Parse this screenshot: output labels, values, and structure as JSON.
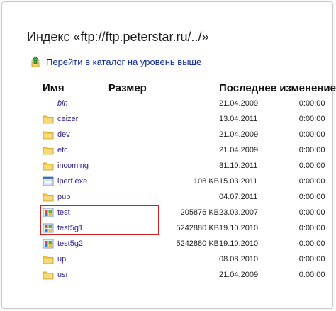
{
  "page": {
    "title": "Индекс «ftp://ftp.peterstar.ru/../»",
    "up_link": "Перейти в каталог на уровень выше"
  },
  "columns": {
    "name": "Имя",
    "size": "Размер",
    "modified": "Последнее изменение"
  },
  "rows": [
    {
      "name": "bin",
      "icon": "none",
      "size": "",
      "date": "21.04.2009",
      "time": "0:00:00",
      "style": "italic"
    },
    {
      "name": "ceizer",
      "icon": "folder-icon",
      "size": "",
      "date": "13.04.2011",
      "time": "0:00:00",
      "style": "normal"
    },
    {
      "name": "dev",
      "icon": "folder-icon",
      "size": "",
      "date": "21.04.2009",
      "time": "0:00:00",
      "style": "normal"
    },
    {
      "name": "etc",
      "icon": "folder-icon",
      "size": "",
      "date": "21.04.2009",
      "time": "0:00:00",
      "style": "normal"
    },
    {
      "name": "incoming",
      "icon": "folder-icon",
      "size": "",
      "date": "31.10.2011",
      "time": "0:00:00",
      "style": "normal"
    },
    {
      "name": "iperf.exe",
      "icon": "exe-file-icon",
      "size": "108 KB",
      "date": "15.03.2011",
      "time": "0:00:00",
      "style": "normal"
    },
    {
      "name": "pub",
      "icon": "folder-icon",
      "size": "",
      "date": "04.07.2011",
      "time": "0:00:00",
      "style": "normal"
    },
    {
      "name": "test",
      "icon": "windows-file-icon",
      "size": "205876 KB",
      "date": "23.03.2007",
      "time": "0:00:00",
      "style": "normal"
    },
    {
      "name": "test5g1",
      "icon": "windows-file-icon",
      "size": "5242880 KB",
      "date": "19.10.2010",
      "time": "0:00:00",
      "style": "normal"
    },
    {
      "name": "test5g2",
      "icon": "windows-file-icon",
      "size": "5242880 KB",
      "date": "19.10.2010",
      "time": "0:00:00",
      "style": "normal"
    },
    {
      "name": "up",
      "icon": "folder-icon",
      "size": "",
      "date": "08.08.2010",
      "time": "0:00:00",
      "style": "normal"
    },
    {
      "name": "usr",
      "icon": "folder-icon",
      "size": "",
      "date": "21.04.2009",
      "time": "0:00:00",
      "style": "normal"
    }
  ],
  "colors": {
    "link": "#2b1d8f",
    "up_link": "#0d2a9c",
    "folder": "#f2c94c",
    "highlight": "#d02020"
  }
}
